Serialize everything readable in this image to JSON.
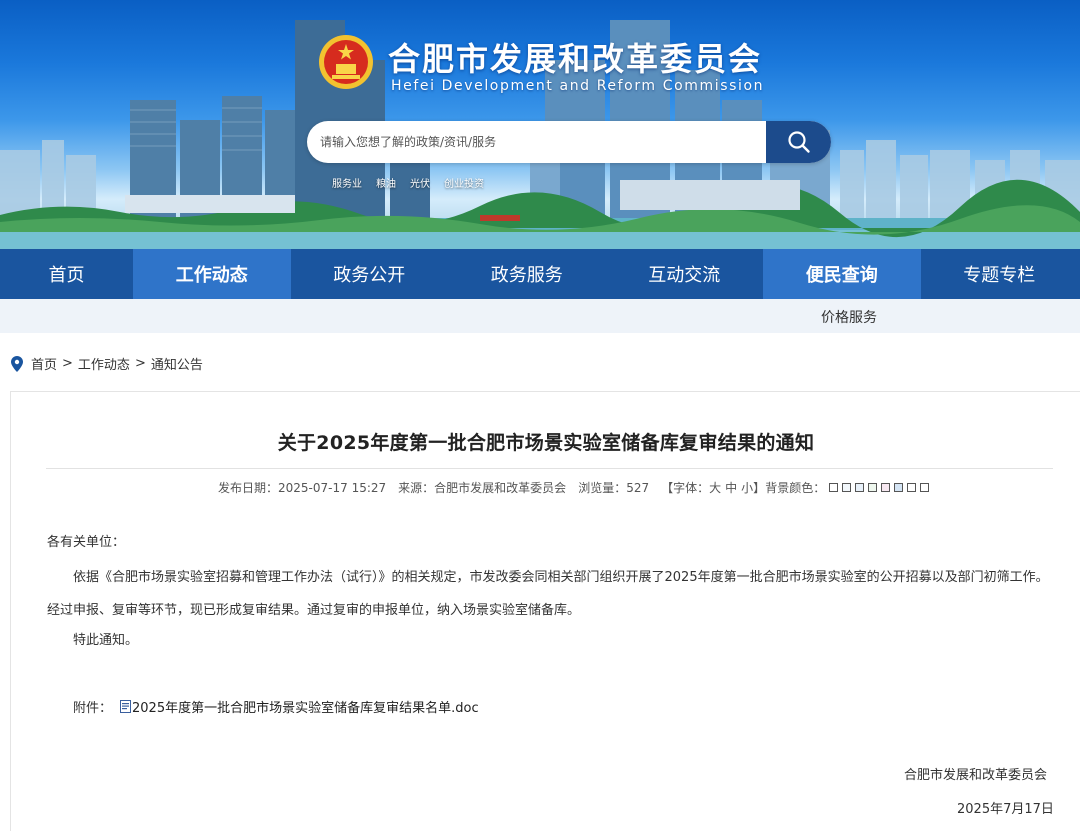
{
  "header": {
    "site_title": "合肥市发展和改革委员会",
    "site_subtitle": "Hefei Development and Reform Commission",
    "search_placeholder": "请输入您想了解的政策/资讯/服务",
    "hot_words": [
      "服务业",
      "粮油",
      "光伏",
      "创业投资"
    ]
  },
  "nav": {
    "items": [
      "首页",
      "工作动态",
      "政务公开",
      "政务服务",
      "互动交流",
      "便民查询",
      "专题专栏"
    ],
    "active": [
      "工作动态",
      "便民查询"
    ]
  },
  "subnav": {
    "item": "价格服务"
  },
  "breadcrumb": {
    "home": "首页",
    "sep": ">",
    "level1": "工作动态",
    "level2": "通知公告"
  },
  "article": {
    "title": "关于2025年度第一批合肥市场景实验室储备库复审结果的通知",
    "meta": {
      "date_label": "发布日期：",
      "date": "2025-07-17 15:27",
      "source_label": "来源：",
      "source": "合肥市发展和改革委员会",
      "views_label": "浏览量：",
      "views": "527",
      "font_label": "【字体：",
      "font_sizes": [
        "大",
        "中",
        "小"
      ],
      "font_close": "】",
      "bg_label": "背景颜色：",
      "bg_colors": [
        "#ffffff",
        "#f2f7fb",
        "#e8f1fa",
        "#eef7ee",
        "#f7e8f1",
        "#d4e4f4",
        "#ffffff",
        "#ffffff"
      ]
    },
    "greeting": "各有关单位：",
    "paragraph": "依据《合肥市场景实验室招募和管理工作办法（试行）》的相关规定，市发改委会同相关部门组织开展了2025年度第一批合肥市场景实验室的公开招募以及部门初筛工作。经过申报、复审等环节，现已形成复审结果。通过复审的申报单位，纳入场景实验室储备库。",
    "closing": "特此通知。",
    "attachment_label": "附件：",
    "attachment_name": "2025年度第一批合肥市场景实验室储备库复审结果名单.doc",
    "signature_org": "合肥市发展和改革委员会",
    "signature_date": "2025年7月17日"
  }
}
